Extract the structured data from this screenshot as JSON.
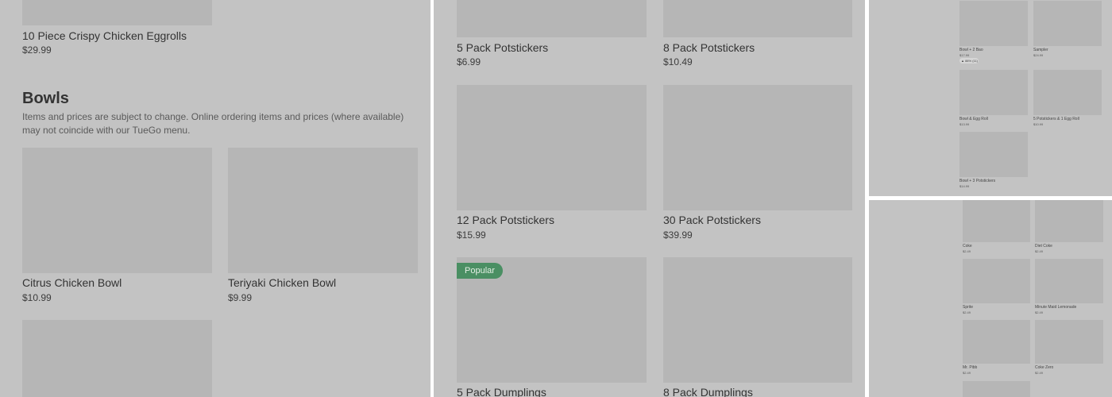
{
  "left_panel": {
    "top_item": {
      "name": "10 Piece Crispy Chicken Eggrolls",
      "price": "$29.99"
    },
    "section": {
      "title": "Bowls",
      "description": "Items and prices are subject to change. Online ordering items and prices (where available) may not coincide with our TueGo menu."
    },
    "items": [
      {
        "name": "Citrus Chicken Bowl",
        "price": "$10.99"
      },
      {
        "name": "Teriyaki Chicken Bowl",
        "price": "$9.99"
      }
    ]
  },
  "middle_panel": {
    "items": [
      {
        "name": "5 Pack Potstickers",
        "price": "$6.99"
      },
      {
        "name": "8 Pack Potstickers",
        "price": "$10.49"
      },
      {
        "name": "12 Pack Potstickers",
        "price": "$15.99"
      },
      {
        "name": "30 Pack Potstickers",
        "price": "$39.99"
      },
      {
        "name": "5 Pack Dumplings",
        "price": ""
      },
      {
        "name": "8 Pack Dumplings",
        "price": ""
      }
    ],
    "popular_badge": "Popular"
  },
  "top_right_panel": {
    "items": [
      {
        "name": "Bowl + 2 Bao",
        "price": "$17.99"
      },
      {
        "name": "Sampler",
        "price": "$24.99"
      },
      {
        "name": "Bowl & Egg Roll",
        "price": "$13.99"
      },
      {
        "name": "5 Potstickers & 1 Egg Roll",
        "price": "$10.99"
      },
      {
        "name": "Bowl + 3 Potstickers",
        "price": "$14.99"
      }
    ],
    "rating": "▲ 88% (11)"
  },
  "bottom_right_panel": {
    "items": [
      {
        "name": "Coke",
        "price": "$2.49"
      },
      {
        "name": "Diet Coke",
        "price": "$2.49"
      },
      {
        "name": "Sprite",
        "price": "$2.49"
      },
      {
        "name": "Minute Maid Lemonade",
        "price": "$2.49"
      },
      {
        "name": "Mr. Pibb",
        "price": "$2.49"
      },
      {
        "name": "Coke Zero",
        "price": "$2.49"
      }
    ]
  }
}
